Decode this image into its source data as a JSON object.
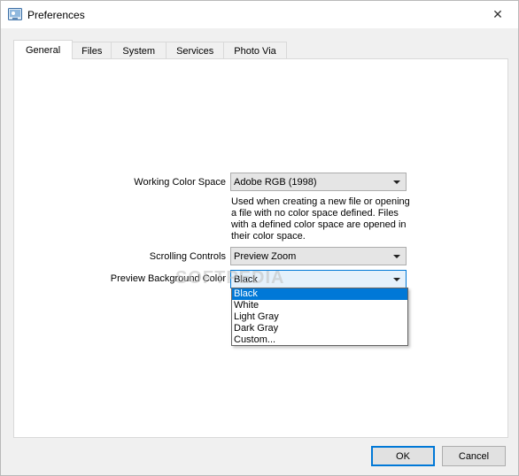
{
  "window": {
    "title": "Preferences",
    "close_glyph": "✕",
    "icon": "preferences-app-icon"
  },
  "tabs": [
    {
      "label": "General",
      "active": true
    },
    {
      "label": "Files",
      "active": false
    },
    {
      "label": "System",
      "active": false
    },
    {
      "label": "Services",
      "active": false
    },
    {
      "label": "Photo Via",
      "active": false
    }
  ],
  "general": {
    "working_color_space": {
      "label": "Working Color Space",
      "value": "Adobe RGB (1998)",
      "description": "Used when creating a new file or opening a file with no color space defined. Files with a defined color space are opened in their color space."
    },
    "scrolling_controls": {
      "label": "Scrolling Controls",
      "value": "Preview Zoom"
    },
    "preview_background_color": {
      "label": "Preview Background Color",
      "value": "Black",
      "options": [
        "Black",
        "White",
        "Light Gray",
        "Dark Gray",
        "Custom..."
      ],
      "selected_index": 0
    }
  },
  "watermark": "SOFTPEDIA",
  "buttons": {
    "ok": "OK",
    "cancel": "Cancel"
  },
  "colors": {
    "accent": "#0078d7"
  }
}
